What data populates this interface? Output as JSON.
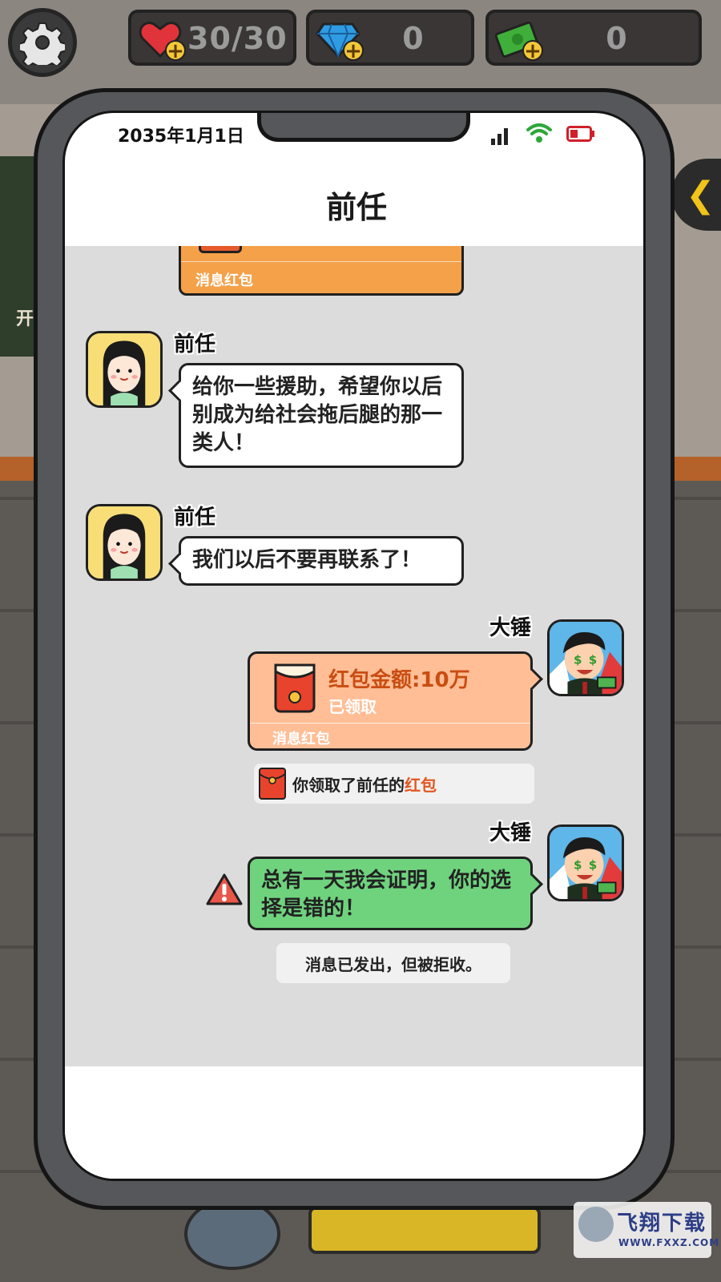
{
  "hud": {
    "hearts": "30/30",
    "gems": "0",
    "cash": "0"
  },
  "status_bar": {
    "date": "2035年1月1日"
  },
  "chat": {
    "title": "前任",
    "top_card_label": "消息红包",
    "messages": [
      {
        "sender": "前任",
        "text": "给你一些援助，希望你以后别成为给社会拖后腿的那一类人！"
      },
      {
        "sender": "前任",
        "text": "我们以后不要再联系了！"
      }
    ],
    "red_packet": {
      "sender": "大锤",
      "amount": "红包金额:10万",
      "status": "已领取",
      "label": "消息红包"
    },
    "received_note": {
      "prefix": "你领取了前任的",
      "highlight": "红包"
    },
    "outgoing": {
      "sender": "大锤",
      "text": "总有一天我会证明，你的选择是错的！"
    },
    "rejected_note": "消息已发出，但被拒收。"
  },
  "background": {
    "left_text": "开"
  },
  "watermark": {
    "text": "飞翔下载",
    "url": "WWW.FXXZ.COM"
  },
  "colors": {
    "green_bubble": "#6fd37e",
    "red_packet_card": "#ffbe96",
    "orange_card": "#f4a14a",
    "highlight": "#e2561f",
    "chat_bg": "#dcdcdd"
  }
}
